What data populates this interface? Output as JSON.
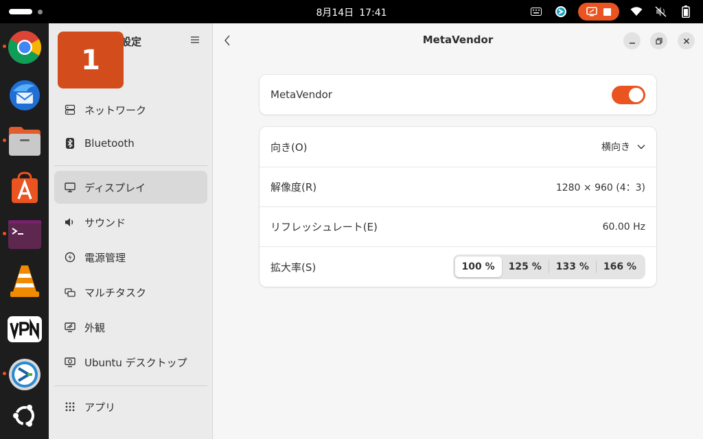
{
  "topbar": {
    "date": "8月14日",
    "time": "17:41"
  },
  "dock": {
    "apps": [
      {
        "icon": "chrome-icon",
        "running": true
      },
      {
        "icon": "thunderbird-icon",
        "running": false
      },
      {
        "icon": "files-icon",
        "running": true
      },
      {
        "icon": "app-center-icon",
        "running": false
      },
      {
        "icon": "terminal-icon",
        "running": true
      },
      {
        "icon": "vlc-icon",
        "running": false
      },
      {
        "icon": "vpn-icon",
        "running": false,
        "label": "VPN"
      },
      {
        "icon": "remmina-icon",
        "running": true
      },
      {
        "icon": "ubuntu-icon",
        "running": false
      }
    ]
  },
  "sidebar": {
    "title": "設定",
    "overlay_badge": "1",
    "items": [
      {
        "label": "ネットワーク",
        "icon": "network-icon"
      },
      {
        "label": "Bluetooth",
        "icon": "bluetooth-icon"
      },
      {
        "label": "ディスプレイ",
        "icon": "display-icon",
        "active": true
      },
      {
        "label": "サウンド",
        "icon": "sound-icon"
      },
      {
        "label": "電源管理",
        "icon": "power-icon"
      },
      {
        "label": "マルチタスク",
        "icon": "multitasking-icon"
      },
      {
        "label": "外観",
        "icon": "appearance-icon"
      },
      {
        "label": "Ubuntu デスクトップ",
        "icon": "ubuntu-desktop-icon"
      },
      {
        "label": "アプリ",
        "icon": "apps-icon"
      }
    ]
  },
  "main": {
    "title": "MetaVendor",
    "monitor_toggle": {
      "label": "MetaVendor",
      "enabled": true
    },
    "rows": {
      "orientation": {
        "label": "向き(O)",
        "value": "横向き"
      },
      "resolution": {
        "label": "解像度(R)",
        "value": "1280 × 960 (4：3)"
      },
      "refresh": {
        "label": "リフレッシュレート(E)",
        "value": "60.00 Hz"
      },
      "scale": {
        "label": "拡大率(S)",
        "options": [
          "100 %",
          "125 %",
          "133 %",
          "166 %"
        ],
        "selected": "100 %"
      }
    }
  },
  "colors": {
    "accent": "#e95420",
    "badge": "#d24d1b"
  }
}
